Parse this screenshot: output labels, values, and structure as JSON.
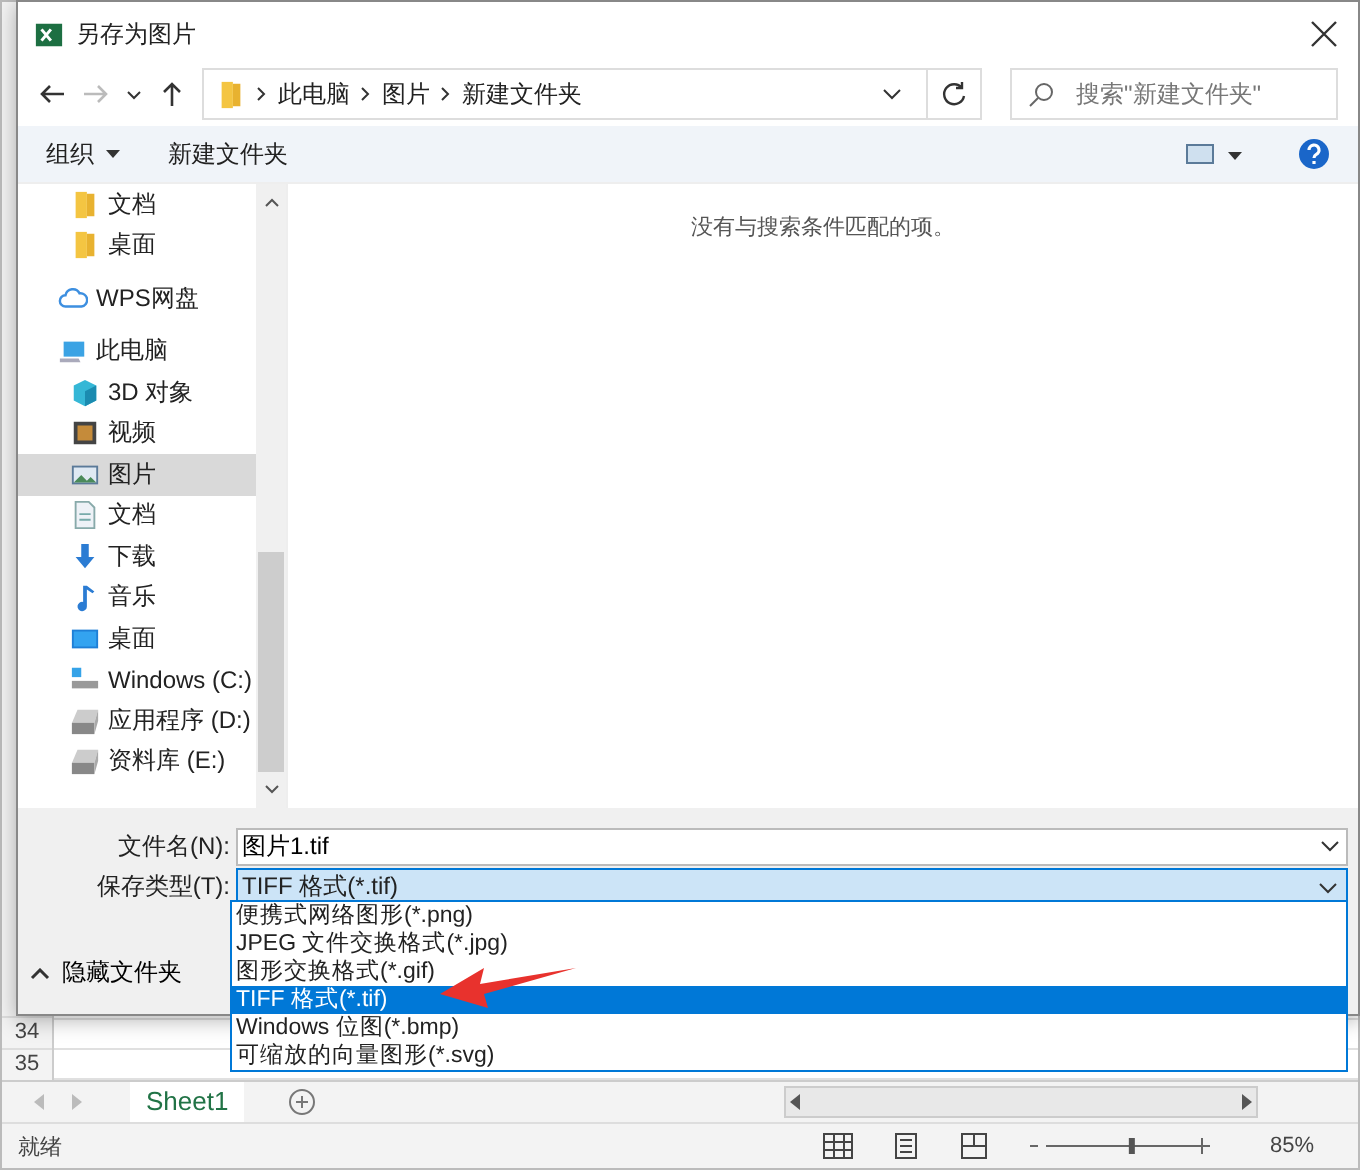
{
  "dialog": {
    "title": "另存为图片",
    "address": {
      "path": [
        "此电脑",
        "图片",
        "新建文件夹"
      ]
    },
    "search": {
      "placeholder": "搜索\"新建文件夹\""
    },
    "toolbar": {
      "organize": "组织",
      "new_folder": "新建文件夹"
    },
    "sidebar": {
      "items": [
        {
          "label": "文档",
          "kind": "folder",
          "selected": false
        },
        {
          "label": "桌面",
          "kind": "folder",
          "selected": false
        },
        {
          "label": "WPS网盘",
          "kind": "cloud",
          "selected": false
        },
        {
          "label": "此电脑",
          "kind": "pc",
          "selected": false,
          "children": [
            {
              "label": "3D 对象",
              "kind": "cube",
              "selected": false
            },
            {
              "label": "视频",
              "kind": "video",
              "selected": false
            },
            {
              "label": "图片",
              "kind": "picture",
              "selected": true
            },
            {
              "label": "文档",
              "kind": "doc",
              "selected": false
            },
            {
              "label": "下载",
              "kind": "download",
              "selected": false
            },
            {
              "label": "音乐",
              "kind": "music",
              "selected": false
            },
            {
              "label": "桌面",
              "kind": "desktop",
              "selected": false
            },
            {
              "label": "Windows (C:)",
              "kind": "system-drive",
              "selected": false
            },
            {
              "label": "应用程序 (D:)",
              "kind": "drive",
              "selected": false
            },
            {
              "label": "资料库 (E:)",
              "kind": "drive",
              "selected": false
            }
          ]
        }
      ]
    },
    "empty_message": "没有与搜索条件匹配的项。",
    "filename": {
      "label": "文件名(N):",
      "value": "图片1.tif"
    },
    "filetype": {
      "label": "保存类型(T):",
      "value": "TIFF 格式(*.tif)",
      "options": [
        {
          "label": "便携式网络图形(*.png)",
          "selected": false
        },
        {
          "label": "JPEG 文件交换格式(*.jpg)",
          "selected": false
        },
        {
          "label": "图形交换格式(*.gif)",
          "selected": false
        },
        {
          "label": "TIFF 格式(*.tif)",
          "selected": true
        },
        {
          "label": "Windows 位图(*.bmp)",
          "selected": false
        },
        {
          "label": "可缩放的向量图形(*.svg)",
          "selected": false
        }
      ]
    },
    "hide_folders": "隐藏文件夹"
  },
  "excel": {
    "rows": [
      "34",
      "35"
    ],
    "sheet_tab": "Sheet1",
    "status": "就绪",
    "zoom": "85%",
    "zoom_slider": {
      "level": 0.58
    }
  }
}
